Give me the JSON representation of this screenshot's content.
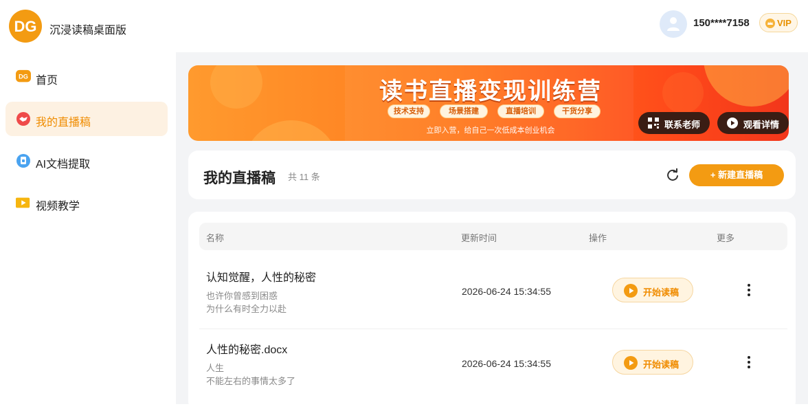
{
  "app": {
    "title": "沉浸读稿桌面版",
    "logo_text": "DG",
    "logo_subtext": "沉浸读稿"
  },
  "user": {
    "phone": "150****7158",
    "vip_label": "VIP"
  },
  "sidebar": {
    "items": [
      {
        "label": "首页",
        "icon": "home-logo-icon",
        "active": false
      },
      {
        "label": "我的直播稿",
        "icon": "handshake-icon",
        "active": true
      },
      {
        "label": "AI文档提取",
        "icon": "document-icon",
        "active": false
      },
      {
        "label": "视频教学",
        "icon": "video-play-icon",
        "active": false
      }
    ]
  },
  "banner": {
    "title": "读书直播变现训练营",
    "tags": [
      "技术支持",
      "场景搭建",
      "直播培训",
      "干货分享"
    ],
    "subtitle": "立即入营，给自己一次低成本创业机会",
    "contact_label": "联系老师",
    "details_label": "观看详情"
  },
  "page": {
    "title": "我的直播稿",
    "count": "共 11 条",
    "new_button": "+ 新建直播稿"
  },
  "table": {
    "headers": [
      "名称",
      "更新时间",
      "操作",
      "更多"
    ],
    "start_label": "开始读稿",
    "rows": [
      {
        "name": "认知觉醒，人性的秘密",
        "desc": [
          "也许你曾感到困惑",
          "为什么有时全力以赴"
        ],
        "updated": "2026-06-24 15:34:55"
      },
      {
        "name": "人性的秘密.docx",
        "desc": [
          "人生",
          "不能左右的事情太多了"
        ],
        "updated": "2026-06-24 15:34:55"
      }
    ]
  },
  "colors": {
    "accent": "#f39b12",
    "active_bg": "#fdf1e2",
    "banner_start": "#ff9a2e",
    "banner_end": "#f2361b"
  }
}
